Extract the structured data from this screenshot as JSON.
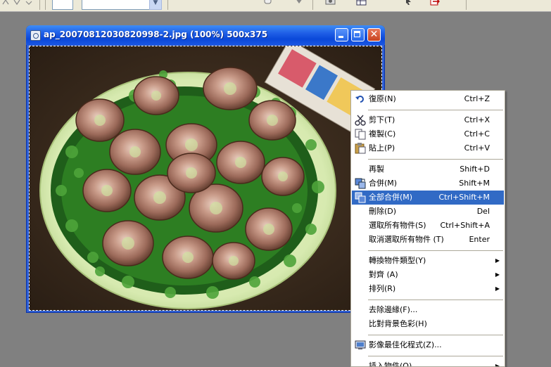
{
  "window": {
    "title": "ap_20070812030820998-2.jpg (100%) 500x375"
  },
  "menu": {
    "items": [
      {
        "label": "復原(N)",
        "shortcut": "Ctrl+Z",
        "icon": "undo-icon"
      },
      {
        "label": "剪下(T)",
        "shortcut": "Ctrl+X",
        "icon": "scissors-icon"
      },
      {
        "label": "複製(C)",
        "shortcut": "Ctrl+C",
        "icon": "copy-icon"
      },
      {
        "label": "貼上(P)",
        "shortcut": "Ctrl+V",
        "icon": "paste-icon"
      },
      {
        "label": "再製",
        "shortcut": "Shift+D"
      },
      {
        "label": "合併(M)",
        "shortcut": "Shift+M",
        "icon": "merge-icon"
      },
      {
        "label": "全部合併(M)",
        "shortcut": "Ctrl+Shift+M",
        "icon": "merge-all-icon"
      },
      {
        "label": "刪除(D)",
        "shortcut": "Del"
      },
      {
        "label": "選取所有物件(S)",
        "shortcut": "Ctrl+Shift+A"
      },
      {
        "label": "取消選取所有物件 (T)",
        "shortcut": "Enter"
      },
      {
        "label": "轉換物件類型(Y)"
      },
      {
        "label": "對齊 (A)"
      },
      {
        "label": "排列(R)"
      },
      {
        "label": "去除邊緣(F)..."
      },
      {
        "label": "比對背景色彩(H)"
      },
      {
        "label": "影像最佳化程式(Z)...",
        "icon": "optimizer-icon"
      },
      {
        "label": "插入物件(O)"
      }
    ]
  },
  "colors": {
    "menu_highlight": "#316ac5",
    "titlebar": "#0a48d9",
    "desktop": "#808080"
  }
}
